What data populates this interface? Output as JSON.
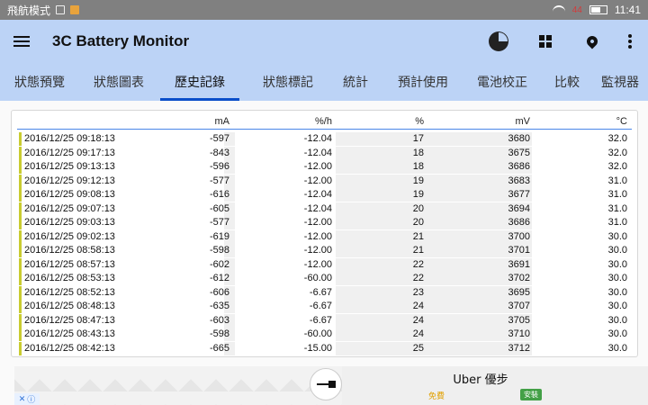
{
  "status_bar": {
    "left_text": "飛航模式",
    "time": "11:41",
    "battery_pct": "44"
  },
  "app_bar": {
    "title": "3C Battery Monitor"
  },
  "tabs": [
    {
      "label": "狀態預覽",
      "active": false
    },
    {
      "label": "狀態圖表",
      "active": false
    },
    {
      "label": "歷史記錄",
      "active": true
    },
    {
      "label": "狀態標記",
      "active": false
    },
    {
      "label": "統計",
      "active": false
    },
    {
      "label": "預計使用",
      "active": false
    },
    {
      "label": "電池校正",
      "active": false
    },
    {
      "label": "比較",
      "active": false
    },
    {
      "label": "監視器",
      "active": false
    }
  ],
  "table": {
    "headers": [
      "mA",
      "%/h",
      "%",
      "mV",
      "°C"
    ],
    "rows": [
      [
        "2016/12/25 09:18:13",
        "-597",
        "-12.04",
        "17",
        "3680",
        "32.0"
      ],
      [
        "2016/12/25 09:17:13",
        "-843",
        "-12.04",
        "18",
        "3675",
        "32.0"
      ],
      [
        "2016/12/25 09:13:13",
        "-596",
        "-12.00",
        "18",
        "3686",
        "32.0"
      ],
      [
        "2016/12/25 09:12:13",
        "-577",
        "-12.00",
        "19",
        "3683",
        "31.0"
      ],
      [
        "2016/12/25 09:08:13",
        "-616",
        "-12.04",
        "19",
        "3677",
        "31.0"
      ],
      [
        "2016/12/25 09:07:13",
        "-605",
        "-12.04",
        "20",
        "3694",
        "31.0"
      ],
      [
        "2016/12/25 09:03:13",
        "-577",
        "-12.00",
        "20",
        "3686",
        "31.0"
      ],
      [
        "2016/12/25 09:02:13",
        "-619",
        "-12.00",
        "21",
        "3700",
        "30.0"
      ],
      [
        "2016/12/25 08:58:13",
        "-598",
        "-12.00",
        "21",
        "3701",
        "30.0"
      ],
      [
        "2016/12/25 08:57:13",
        "-602",
        "-12.00",
        "22",
        "3691",
        "30.0"
      ],
      [
        "2016/12/25 08:53:13",
        "-612",
        "-60.00",
        "22",
        "3702",
        "30.0"
      ],
      [
        "2016/12/25 08:52:13",
        "-606",
        "-6.67",
        "23",
        "3695",
        "30.0"
      ],
      [
        "2016/12/25 08:48:13",
        "-635",
        "-6.67",
        "24",
        "3707",
        "30.0"
      ],
      [
        "2016/12/25 08:47:13",
        "-603",
        "-6.67",
        "24",
        "3705",
        "30.0"
      ],
      [
        "2016/12/25 08:43:13",
        "-598",
        "-60.00",
        "24",
        "3710",
        "30.0"
      ],
      [
        "2016/12/25 08:42:13",
        "-665",
        "-15.00",
        "25",
        "3712",
        "30.0"
      ]
    ]
  },
  "ad": {
    "title": "Uber 優步",
    "free_label": "免費",
    "install_label": "安裝"
  },
  "colors": {
    "app_bar": "#bcd3f6",
    "tab_indicator": "#0a4ec9",
    "row_marker": "#c9cc31",
    "header_rule": "#4a86e8"
  }
}
